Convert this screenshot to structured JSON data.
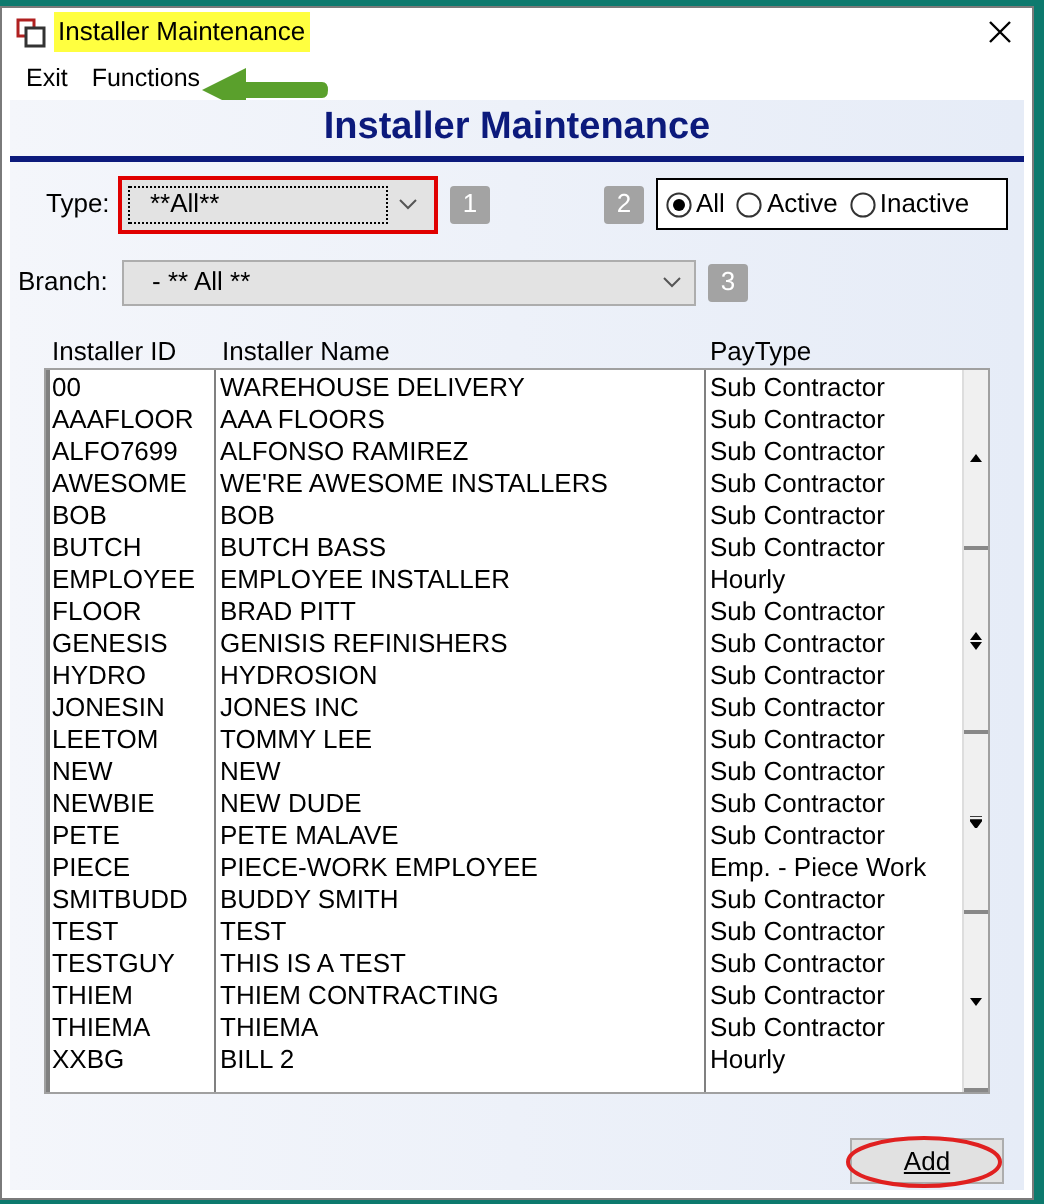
{
  "window": {
    "title": "Installer Maintenance",
    "title_highlighted": true
  },
  "menu": [
    {
      "label": "Exit"
    },
    {
      "label": "Functions"
    }
  ],
  "heading": "Installer Maintenance",
  "type_filter": {
    "label": "Type:",
    "value": "**All**",
    "highlighted": true,
    "badge": "1"
  },
  "status_filter": {
    "badge": "2",
    "options": [
      {
        "label": "All",
        "selected": true
      },
      {
        "label": "Active",
        "selected": false
      },
      {
        "label": "Inactive",
        "selected": false
      }
    ]
  },
  "branch_filter": {
    "label": "Branch:",
    "value": "- ** All **",
    "badge": "3"
  },
  "table": {
    "columns": [
      "Installer ID",
      "Installer Name",
      "PayType"
    ],
    "rows": [
      [
        "00",
        "WAREHOUSE DELIVERY",
        "Sub Contractor"
      ],
      [
        "AAAFLOOR",
        "AAA FLOORS",
        "Sub Contractor"
      ],
      [
        "ALFO7699",
        "ALFONSO RAMIREZ",
        "Sub Contractor"
      ],
      [
        "AWESOME",
        "WE'RE AWESOME INSTALLERS",
        "Sub Contractor"
      ],
      [
        "BOB",
        "BOB",
        "Sub Contractor"
      ],
      [
        "BUTCH",
        "BUTCH BASS",
        "Sub Contractor"
      ],
      [
        "EMPLOYEE",
        "EMPLOYEE INSTALLER",
        "Hourly"
      ],
      [
        "FLOOR",
        "BRAD PITT",
        "Sub Contractor"
      ],
      [
        "GENESIS",
        "GENISIS REFINISHERS",
        "Sub Contractor"
      ],
      [
        "HYDRO",
        "HYDROSION",
        "Sub Contractor"
      ],
      [
        "JONESIN",
        "JONES INC",
        "Sub Contractor"
      ],
      [
        "LEETOM",
        "TOMMY LEE",
        "Sub Contractor"
      ],
      [
        "NEW",
        "NEW",
        "Sub Contractor"
      ],
      [
        "NEWBIE",
        "NEW DUDE",
        "Sub Contractor"
      ],
      [
        "PETE",
        "PETE MALAVE",
        "Sub Contractor"
      ],
      [
        "PIECE",
        "PIECE-WORK EMPLOYEE",
        "Emp. - Piece Work"
      ],
      [
        "SMITBUDD",
        "BUDDY SMITH",
        "Sub Contractor"
      ],
      [
        "TEST",
        "TEST",
        "Sub Contractor"
      ],
      [
        "TESTGUY",
        "THIS IS A TEST",
        "Sub Contractor"
      ],
      [
        "THIEM",
        "THIEM CONTRACTING",
        "Sub Contractor"
      ],
      [
        "THIEMA",
        "THIEMA",
        "Sub Contractor"
      ],
      [
        "XXBG",
        "BILL 2",
        "Hourly"
      ]
    ]
  },
  "add_button": {
    "label": "Add",
    "circled": true
  }
}
